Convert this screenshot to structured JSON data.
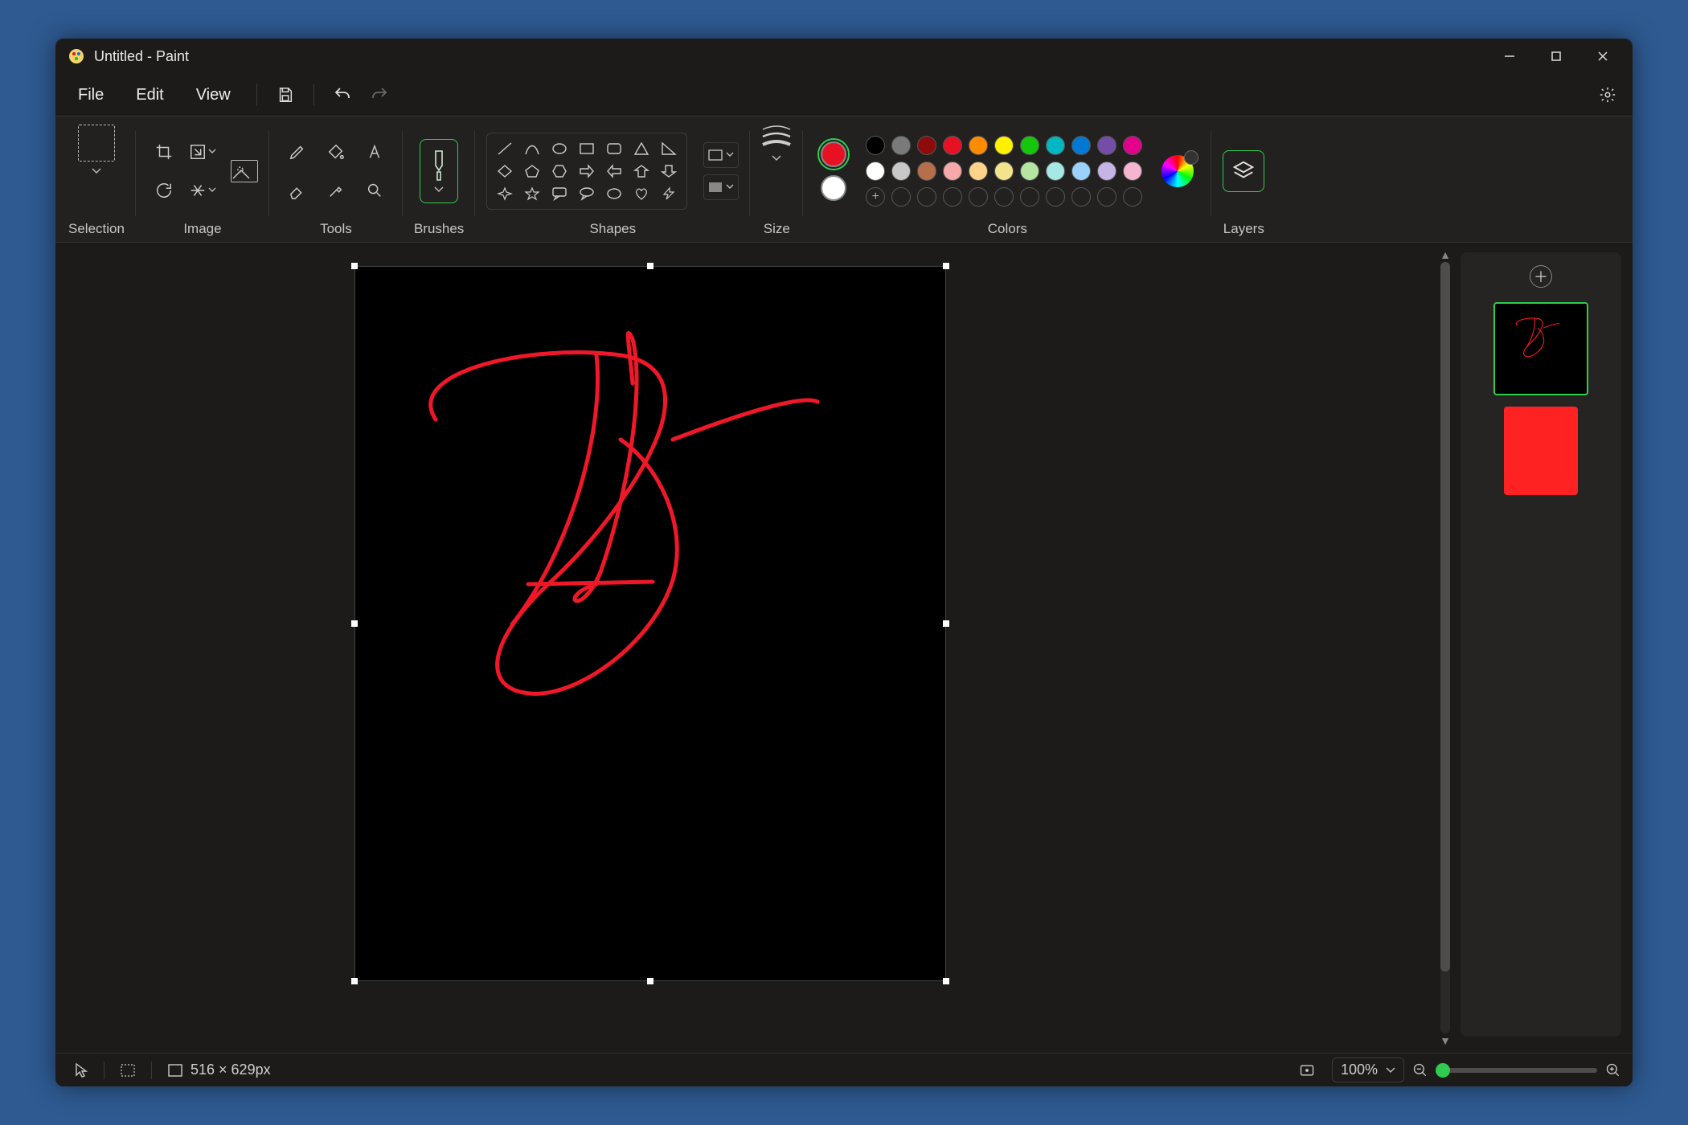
{
  "window": {
    "title": "Untitled - Paint"
  },
  "menu": {
    "file": "File",
    "edit": "Edit",
    "view": "View"
  },
  "ribbon": {
    "selection": "Selection",
    "image": "Image",
    "tools": "Tools",
    "brushes": "Brushes",
    "shapes": "Shapes",
    "size": "Size",
    "colors": "Colors",
    "layers": "Layers"
  },
  "colors": {
    "active1": "#e81123",
    "active2": "#ffffff",
    "row1": [
      "#000000",
      "#7a7a7a",
      "#8e0b0b",
      "#e81123",
      "#ff8c00",
      "#fff100",
      "#16c60c",
      "#00b7c3",
      "#0078d4",
      "#744da9",
      "#e3008c"
    ],
    "row2": [
      "#ffffff",
      "#c8c8c8",
      "#b76e4b",
      "#f7a8a8",
      "#ffd38c",
      "#f4e38d",
      "#b5e6a1",
      "#a6e9e4",
      "#9bd1ff",
      "#c7b4e6",
      "#f5b5d0"
    ]
  },
  "status": {
    "canvas_size": "516 × 629px",
    "zoom": "100%"
  }
}
